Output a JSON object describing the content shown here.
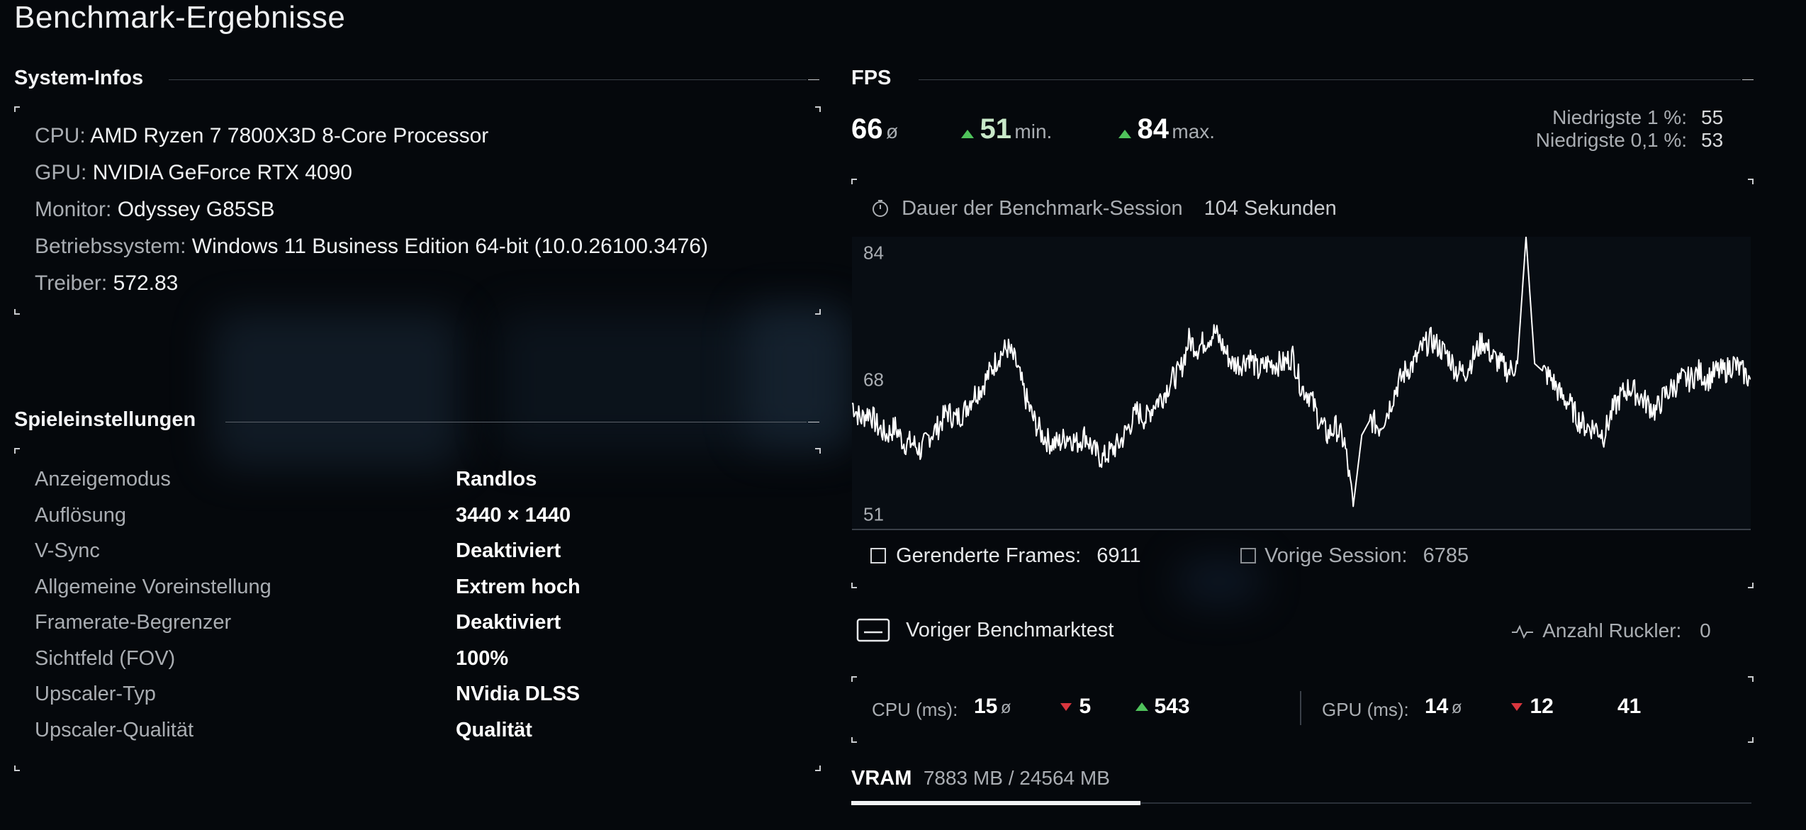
{
  "page_title": "Benchmark-Ergebnisse",
  "system_info": {
    "heading": "System-Infos",
    "rows": [
      {
        "label": "CPU:",
        "value": "AMD Ryzen 7 7800X3D 8-Core Processor"
      },
      {
        "label": "GPU:",
        "value": "NVIDIA GeForce RTX 4090"
      },
      {
        "label": "Monitor:",
        "value": "Odyssey G85SB"
      },
      {
        "label": "Betriebssystem:",
        "value": "Windows 11 Business Edition 64-bit (10.0.26100.3476)"
      },
      {
        "label": "Treiber:",
        "value": "572.83"
      }
    ]
  },
  "game_settings": {
    "heading": "Spieleinstellungen",
    "rows": [
      {
        "label": "Anzeigemodus",
        "value": "Randlos"
      },
      {
        "label": "Auflösung",
        "value": "3440 × 1440"
      },
      {
        "label": "V-Sync",
        "value": "Deaktiviert"
      },
      {
        "label": "Allgemeine Voreinstellung",
        "value": "Extrem hoch"
      },
      {
        "label": "Framerate-Begrenzer",
        "value": "Deaktiviert"
      },
      {
        "label": "Sichtfeld (FOV)",
        "value": "100%"
      },
      {
        "label": "Upscaler-Typ",
        "value": "NVidia DLSS"
      },
      {
        "label": "Upscaler-Qualität",
        "value": "Qualität"
      }
    ]
  },
  "fps": {
    "heading": "FPS",
    "avg": "66",
    "avg_unit": "ø",
    "min": "51",
    "min_unit": "min.",
    "max": "84",
    "max_unit": "max.",
    "low1_label": "Niedrigste 1 %:",
    "low1_value": "55",
    "low01_label": "Niedrigste 0,1 %:",
    "low01_value": "53",
    "session_label": "Dauer der Benchmark-Session",
    "session_value": "104 Sekunden",
    "rendered_label": "Gerenderte Frames:",
    "rendered_value": "6911",
    "previous_label": "Vorige Session:",
    "previous_value": "6785"
  },
  "chart_data": {
    "type": "line",
    "title": "",
    "xlabel": "",
    "ylabel": "",
    "y_ticks": [
      "84",
      "68",
      "51"
    ],
    "ylim": [
      49,
      86
    ],
    "xlim": [
      0,
      104
    ],
    "grid": false,
    "series": [
      {
        "color": "#ffffff",
        "points": [
          [
            0,
            65
          ],
          [
            1,
            63
          ],
          [
            2,
            64
          ],
          [
            3,
            62
          ],
          [
            4,
            61
          ],
          [
            5,
            62
          ],
          [
            6,
            60
          ],
          [
            7,
            60
          ],
          [
            8,
            59
          ],
          [
            9,
            61
          ],
          [
            10,
            62
          ],
          [
            11,
            64
          ],
          [
            12,
            63
          ],
          [
            13,
            64
          ],
          [
            14,
            66
          ],
          [
            15,
            67
          ],
          [
            16,
            69
          ],
          [
            17,
            71
          ],
          [
            18,
            72
          ],
          [
            19,
            70
          ],
          [
            20,
            66
          ],
          [
            21,
            63
          ],
          [
            22,
            61
          ],
          [
            23,
            60
          ],
          [
            24,
            60
          ],
          [
            25,
            61
          ],
          [
            26,
            60
          ],
          [
            27,
            61
          ],
          [
            28,
            59
          ],
          [
            29,
            58
          ],
          [
            30,
            59
          ],
          [
            31,
            60
          ],
          [
            32,
            62
          ],
          [
            33,
            64
          ],
          [
            34,
            63
          ],
          [
            35,
            65
          ],
          [
            36,
            66
          ],
          [
            37,
            68
          ],
          [
            38,
            69
          ],
          [
            39,
            73
          ],
          [
            40,
            72
          ],
          [
            41,
            73
          ],
          [
            42,
            74
          ],
          [
            43,
            72
          ],
          [
            44,
            70
          ],
          [
            45,
            70
          ],
          [
            46,
            71
          ],
          [
            47,
            69
          ],
          [
            48,
            70
          ],
          [
            49,
            70
          ],
          [
            50,
            70
          ],
          [
            51,
            71
          ],
          [
            52,
            67
          ],
          [
            53,
            66
          ],
          [
            54,
            63
          ],
          [
            55,
            61
          ],
          [
            56,
            62
          ],
          [
            57,
            60
          ],
          [
            58,
            52
          ],
          [
            59,
            61
          ],
          [
            60,
            63
          ],
          [
            61,
            62
          ],
          [
            62,
            64
          ],
          [
            63,
            67
          ],
          [
            64,
            69
          ],
          [
            65,
            70
          ],
          [
            66,
            72
          ],
          [
            67,
            73
          ],
          [
            68,
            72
          ],
          [
            69,
            71
          ],
          [
            70,
            69
          ],
          [
            71,
            69
          ],
          [
            72,
            71
          ],
          [
            73,
            73
          ],
          [
            74,
            71
          ],
          [
            75,
            70
          ],
          [
            76,
            69
          ],
          [
            77,
            70
          ],
          [
            78,
            86
          ],
          [
            79,
            70
          ],
          [
            80,
            69
          ],
          [
            81,
            68
          ],
          [
            82,
            66
          ],
          [
            83,
            65
          ],
          [
            84,
            63
          ],
          [
            85,
            62
          ],
          [
            86,
            62
          ],
          [
            87,
            61
          ],
          [
            88,
            64
          ],
          [
            89,
            66
          ],
          [
            90,
            67
          ],
          [
            91,
            66
          ],
          [
            92,
            65
          ],
          [
            93,
            64
          ],
          [
            94,
            66
          ],
          [
            95,
            67
          ],
          [
            96,
            68
          ],
          [
            97,
            68
          ],
          [
            98,
            69
          ],
          [
            99,
            68
          ],
          [
            100,
            69
          ],
          [
            101,
            69
          ],
          [
            102,
            70
          ],
          [
            103,
            69
          ],
          [
            104,
            68
          ]
        ]
      }
    ]
  },
  "previous_benchmark": {
    "label": "Voriger Benchmarktest",
    "stutter_label": "Anzahl Ruckler:",
    "stutter_value": "0"
  },
  "cpu_gpu": {
    "cpu_label": "CPU (ms):",
    "cpu_avg": "15",
    "cpu_down": "5",
    "cpu_up": "543",
    "gpu_label": "GPU (ms):",
    "gpu_avg": "14",
    "gpu_down": "12",
    "gpu_up": "41",
    "avg_unit": "ø"
  },
  "vram": {
    "label": "VRAM",
    "value": "7883 MB / 24564 MB",
    "used": 7883,
    "total": 24564
  },
  "colors": {
    "background": "#05080c",
    "up": "#4fc25b",
    "down": "#d9363e"
  }
}
